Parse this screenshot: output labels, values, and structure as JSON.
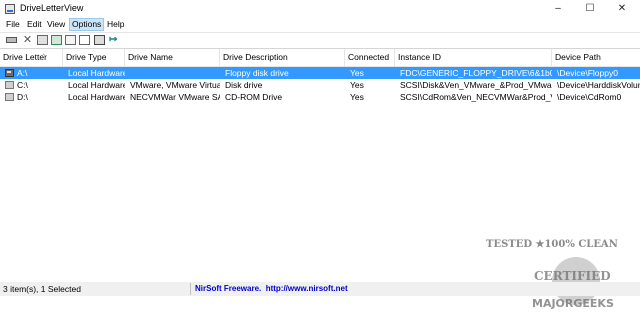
{
  "window": {
    "title": "DriveLetterView",
    "minimize": "–",
    "maximize": "☐",
    "close": "✕"
  },
  "menu": [
    "File",
    "Edit",
    "View",
    "Options",
    "Help"
  ],
  "toolbar": [
    "disconnect-drive-icon",
    "delete-icon",
    "change-drive-letter-icon",
    "refresh-icon",
    "properties-icon",
    "copy-icon",
    "html-report-icon",
    "exit-icon"
  ],
  "columns": [
    "Drive Letter",
    "Drive Type",
    "Drive Name",
    "Drive Description",
    "Connected",
    "Instance ID",
    "Device Path"
  ],
  "rows": [
    {
      "letter": "A:\\",
      "type": "Local Hardware",
      "name": "",
      "description": "Floppy disk drive",
      "connected": "Yes",
      "instance": "FDC\\GENERIC_FLOPPY_DRIVE\\6&1b0d1d81...",
      "path": "\\Device\\Floppy0",
      "selected": true,
      "icon": "floppy-drive-icon"
    },
    {
      "letter": "C:\\",
      "type": "Local Hardware",
      "name": "VMware, VMware Virtual...",
      "description": "Disk drive",
      "connected": "Yes",
      "instance": "SCSI\\Disk&Ven_VMware_&Prod_VMware_V...",
      "path": "\\Device\\HarddiskVolume",
      "selected": false,
      "icon": "hard-drive-icon"
    },
    {
      "letter": "D:\\",
      "type": "Local Hardware",
      "name": "NECVMWar VMware SA...",
      "description": "CD-ROM Drive",
      "connected": "Yes",
      "instance": "SCSI\\CdRom&Ven_NECVMWar&Prod_VM...",
      "path": "\\Device\\CdRom0",
      "selected": false,
      "icon": "cd-drive-icon"
    }
  ],
  "status": {
    "items": "3 item(s), 1 Selected",
    "link": "NirSoft Freeware.  http://www.nirsoft.net"
  },
  "watermark": {
    "line1": "TESTED ★100% CLEAN",
    "line2": "CERTIFIED",
    "line3": "MAJORGEEKS"
  },
  "colors": {
    "selection": "#3399ff",
    "menu_active": "#cce4f7",
    "link": "#0000cc"
  }
}
